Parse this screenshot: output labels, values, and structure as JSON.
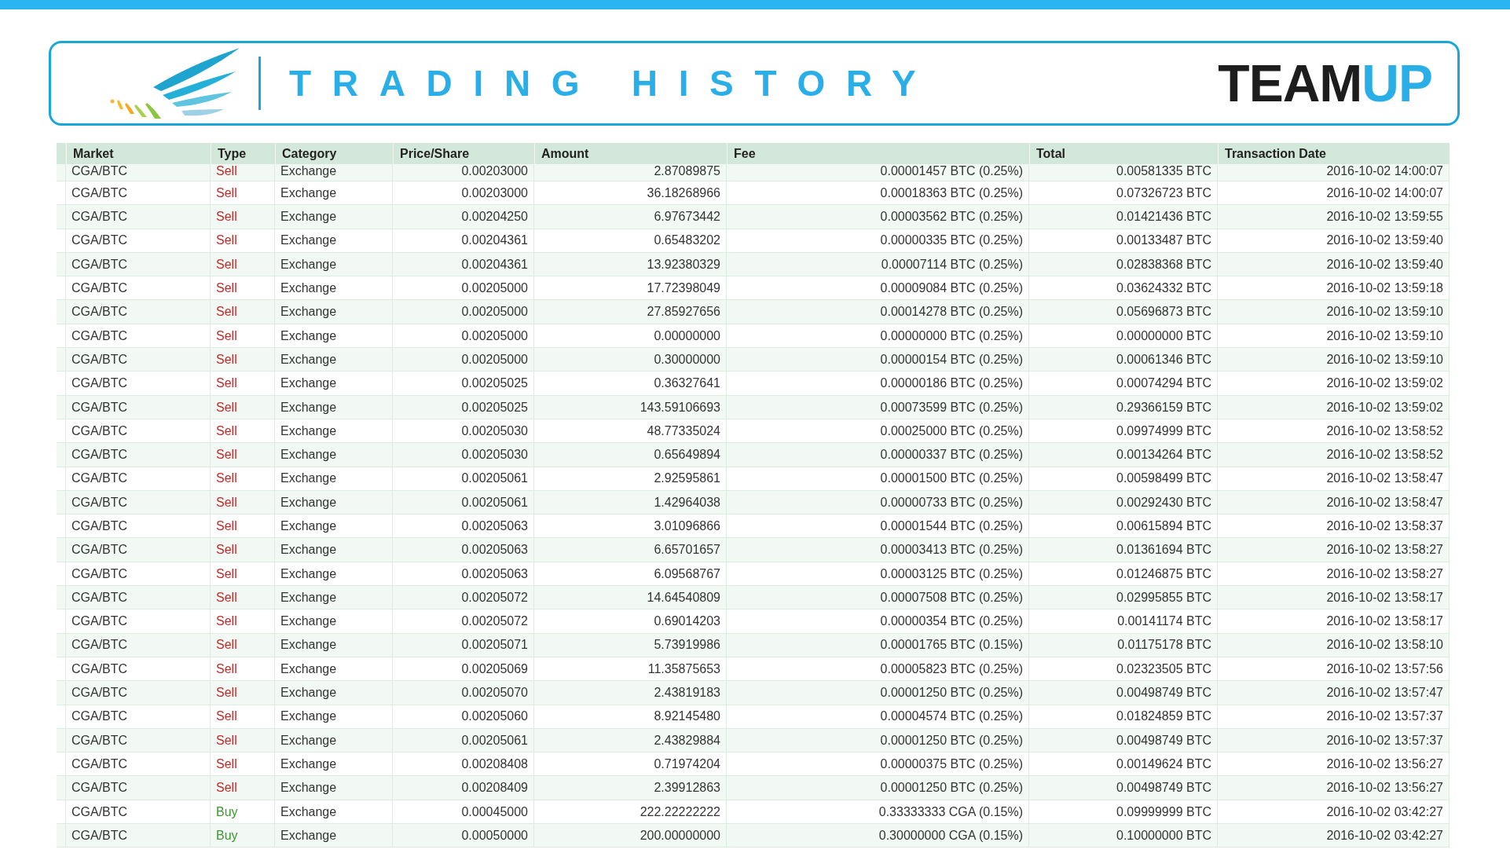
{
  "header": {
    "title": "TRADING HISTORY",
    "logo_dark": "TEAM",
    "logo_accent": "UP"
  },
  "table": {
    "columns": [
      "Market",
      "Type",
      "Category",
      "Price/Share",
      "Amount",
      "Fee",
      "Total",
      "Transaction Date"
    ],
    "rows": [
      {
        "market": "CGA/BTC",
        "type": "Sell",
        "kind": "sell",
        "category": "Exchange",
        "price": "0.00203000",
        "amount": "2.87089875",
        "fee": "0.00001457 BTC (0.25%)",
        "total": "0.00581335 BTC",
        "date": "2016-10-02 14:00:07"
      },
      {
        "market": "CGA/BTC",
        "type": "Sell",
        "kind": "sell",
        "category": "Exchange",
        "price": "0.00203000",
        "amount": "36.18268966",
        "fee": "0.00018363 BTC (0.25%)",
        "total": "0.07326723 BTC",
        "date": "2016-10-02 14:00:07"
      },
      {
        "market": "CGA/BTC",
        "type": "Sell",
        "kind": "sell",
        "category": "Exchange",
        "price": "0.00204250",
        "amount": "6.97673442",
        "fee": "0.00003562 BTC (0.25%)",
        "total": "0.01421436 BTC",
        "date": "2016-10-02 13:59:55"
      },
      {
        "market": "CGA/BTC",
        "type": "Sell",
        "kind": "sell",
        "category": "Exchange",
        "price": "0.00204361",
        "amount": "0.65483202",
        "fee": "0.00000335 BTC (0.25%)",
        "total": "0.00133487 BTC",
        "date": "2016-10-02 13:59:40"
      },
      {
        "market": "CGA/BTC",
        "type": "Sell",
        "kind": "sell",
        "category": "Exchange",
        "price": "0.00204361",
        "amount": "13.92380329",
        "fee": "0.00007114 BTC (0.25%)",
        "total": "0.02838368 BTC",
        "date": "2016-10-02 13:59:40"
      },
      {
        "market": "CGA/BTC",
        "type": "Sell",
        "kind": "sell",
        "category": "Exchange",
        "price": "0.00205000",
        "amount": "17.72398049",
        "fee": "0.00009084 BTC (0.25%)",
        "total": "0.03624332 BTC",
        "date": "2016-10-02 13:59:18"
      },
      {
        "market": "CGA/BTC",
        "type": "Sell",
        "kind": "sell",
        "category": "Exchange",
        "price": "0.00205000",
        "amount": "27.85927656",
        "fee": "0.00014278 BTC (0.25%)",
        "total": "0.05696873 BTC",
        "date": "2016-10-02 13:59:10"
      },
      {
        "market": "CGA/BTC",
        "type": "Sell",
        "kind": "sell",
        "category": "Exchange",
        "price": "0.00205000",
        "amount": "0.00000000",
        "fee": "0.00000000 BTC (0.25%)",
        "total": "0.00000000 BTC",
        "date": "2016-10-02 13:59:10"
      },
      {
        "market": "CGA/BTC",
        "type": "Sell",
        "kind": "sell",
        "category": "Exchange",
        "price": "0.00205000",
        "amount": "0.30000000",
        "fee": "0.00000154 BTC (0.25%)",
        "total": "0.00061346 BTC",
        "date": "2016-10-02 13:59:10"
      },
      {
        "market": "CGA/BTC",
        "type": "Sell",
        "kind": "sell",
        "category": "Exchange",
        "price": "0.00205025",
        "amount": "0.36327641",
        "fee": "0.00000186 BTC (0.25%)",
        "total": "0.00074294 BTC",
        "date": "2016-10-02 13:59:02"
      },
      {
        "market": "CGA/BTC",
        "type": "Sell",
        "kind": "sell",
        "category": "Exchange",
        "price": "0.00205025",
        "amount": "143.59106693",
        "fee": "0.00073599 BTC (0.25%)",
        "total": "0.29366159 BTC",
        "date": "2016-10-02 13:59:02"
      },
      {
        "market": "CGA/BTC",
        "type": "Sell",
        "kind": "sell",
        "category": "Exchange",
        "price": "0.00205030",
        "amount": "48.77335024",
        "fee": "0.00025000 BTC (0.25%)",
        "total": "0.09974999 BTC",
        "date": "2016-10-02 13:58:52"
      },
      {
        "market": "CGA/BTC",
        "type": "Sell",
        "kind": "sell",
        "category": "Exchange",
        "price": "0.00205030",
        "amount": "0.65649894",
        "fee": "0.00000337 BTC (0.25%)",
        "total": "0.00134264 BTC",
        "date": "2016-10-02 13:58:52"
      },
      {
        "market": "CGA/BTC",
        "type": "Sell",
        "kind": "sell",
        "category": "Exchange",
        "price": "0.00205061",
        "amount": "2.92595861",
        "fee": "0.00001500 BTC (0.25%)",
        "total": "0.00598499 BTC",
        "date": "2016-10-02 13:58:47"
      },
      {
        "market": "CGA/BTC",
        "type": "Sell",
        "kind": "sell",
        "category": "Exchange",
        "price": "0.00205061",
        "amount": "1.42964038",
        "fee": "0.00000733 BTC (0.25%)",
        "total": "0.00292430 BTC",
        "date": "2016-10-02 13:58:47"
      },
      {
        "market": "CGA/BTC",
        "type": "Sell",
        "kind": "sell",
        "category": "Exchange",
        "price": "0.00205063",
        "amount": "3.01096866",
        "fee": "0.00001544 BTC (0.25%)",
        "total": "0.00615894 BTC",
        "date": "2016-10-02 13:58:37"
      },
      {
        "market": "CGA/BTC",
        "type": "Sell",
        "kind": "sell",
        "category": "Exchange",
        "price": "0.00205063",
        "amount": "6.65701657",
        "fee": "0.00003413 BTC (0.25%)",
        "total": "0.01361694 BTC",
        "date": "2016-10-02 13:58:27"
      },
      {
        "market": "CGA/BTC",
        "type": "Sell",
        "kind": "sell",
        "category": "Exchange",
        "price": "0.00205063",
        "amount": "6.09568767",
        "fee": "0.00003125 BTC (0.25%)",
        "total": "0.01246875 BTC",
        "date": "2016-10-02 13:58:27"
      },
      {
        "market": "CGA/BTC",
        "type": "Sell",
        "kind": "sell",
        "category": "Exchange",
        "price": "0.00205072",
        "amount": "14.64540809",
        "fee": "0.00007508 BTC (0.25%)",
        "total": "0.02995855 BTC",
        "date": "2016-10-02 13:58:17"
      },
      {
        "market": "CGA/BTC",
        "type": "Sell",
        "kind": "sell",
        "category": "Exchange",
        "price": "0.00205072",
        "amount": "0.69014203",
        "fee": "0.00000354 BTC (0.25%)",
        "total": "0.00141174 BTC",
        "date": "2016-10-02 13:58:17"
      },
      {
        "market": "CGA/BTC",
        "type": "Sell",
        "kind": "sell",
        "category": "Exchange",
        "price": "0.00205071",
        "amount": "5.73919986",
        "fee": "0.00001765 BTC (0.15%)",
        "total": "0.01175178 BTC",
        "date": "2016-10-02 13:58:10"
      },
      {
        "market": "CGA/BTC",
        "type": "Sell",
        "kind": "sell",
        "category": "Exchange",
        "price": "0.00205069",
        "amount": "11.35875653",
        "fee": "0.00005823 BTC (0.25%)",
        "total": "0.02323505 BTC",
        "date": "2016-10-02 13:57:56"
      },
      {
        "market": "CGA/BTC",
        "type": "Sell",
        "kind": "sell",
        "category": "Exchange",
        "price": "0.00205070",
        "amount": "2.43819183",
        "fee": "0.00001250 BTC (0.25%)",
        "total": "0.00498749 BTC",
        "date": "2016-10-02 13:57:47"
      },
      {
        "market": "CGA/BTC",
        "type": "Sell",
        "kind": "sell",
        "category": "Exchange",
        "price": "0.00205060",
        "amount": "8.92145480",
        "fee": "0.00004574 BTC (0.25%)",
        "total": "0.01824859 BTC",
        "date": "2016-10-02 13:57:37"
      },
      {
        "market": "CGA/BTC",
        "type": "Sell",
        "kind": "sell",
        "category": "Exchange",
        "price": "0.00205061",
        "amount": "2.43829884",
        "fee": "0.00001250 BTC (0.25%)",
        "total": "0.00498749 BTC",
        "date": "2016-10-02 13:57:37"
      },
      {
        "market": "CGA/BTC",
        "type": "Sell",
        "kind": "sell",
        "category": "Exchange",
        "price": "0.00208408",
        "amount": "0.71974204",
        "fee": "0.00000375 BTC (0.25%)",
        "total": "0.00149624 BTC",
        "date": "2016-10-02 13:56:27"
      },
      {
        "market": "CGA/BTC",
        "type": "Sell",
        "kind": "sell",
        "category": "Exchange",
        "price": "0.00208409",
        "amount": "2.39912863",
        "fee": "0.00001250 BTC (0.25%)",
        "total": "0.00498749 BTC",
        "date": "2016-10-02 13:56:27"
      },
      {
        "market": "CGA/BTC",
        "type": "Buy",
        "kind": "buy",
        "category": "Exchange",
        "price": "0.00045000",
        "amount": "222.22222222",
        "fee": "0.33333333 CGA (0.15%)",
        "total": "0.09999999 BTC",
        "date": "2016-10-02 03:42:27"
      },
      {
        "market": "CGA/BTC",
        "type": "Buy",
        "kind": "buy",
        "category": "Exchange",
        "price": "0.00050000",
        "amount": "200.00000000",
        "fee": "0.30000000 CGA (0.15%)",
        "total": "0.10000000 BTC",
        "date": "2016-10-02 03:42:27"
      }
    ]
  }
}
